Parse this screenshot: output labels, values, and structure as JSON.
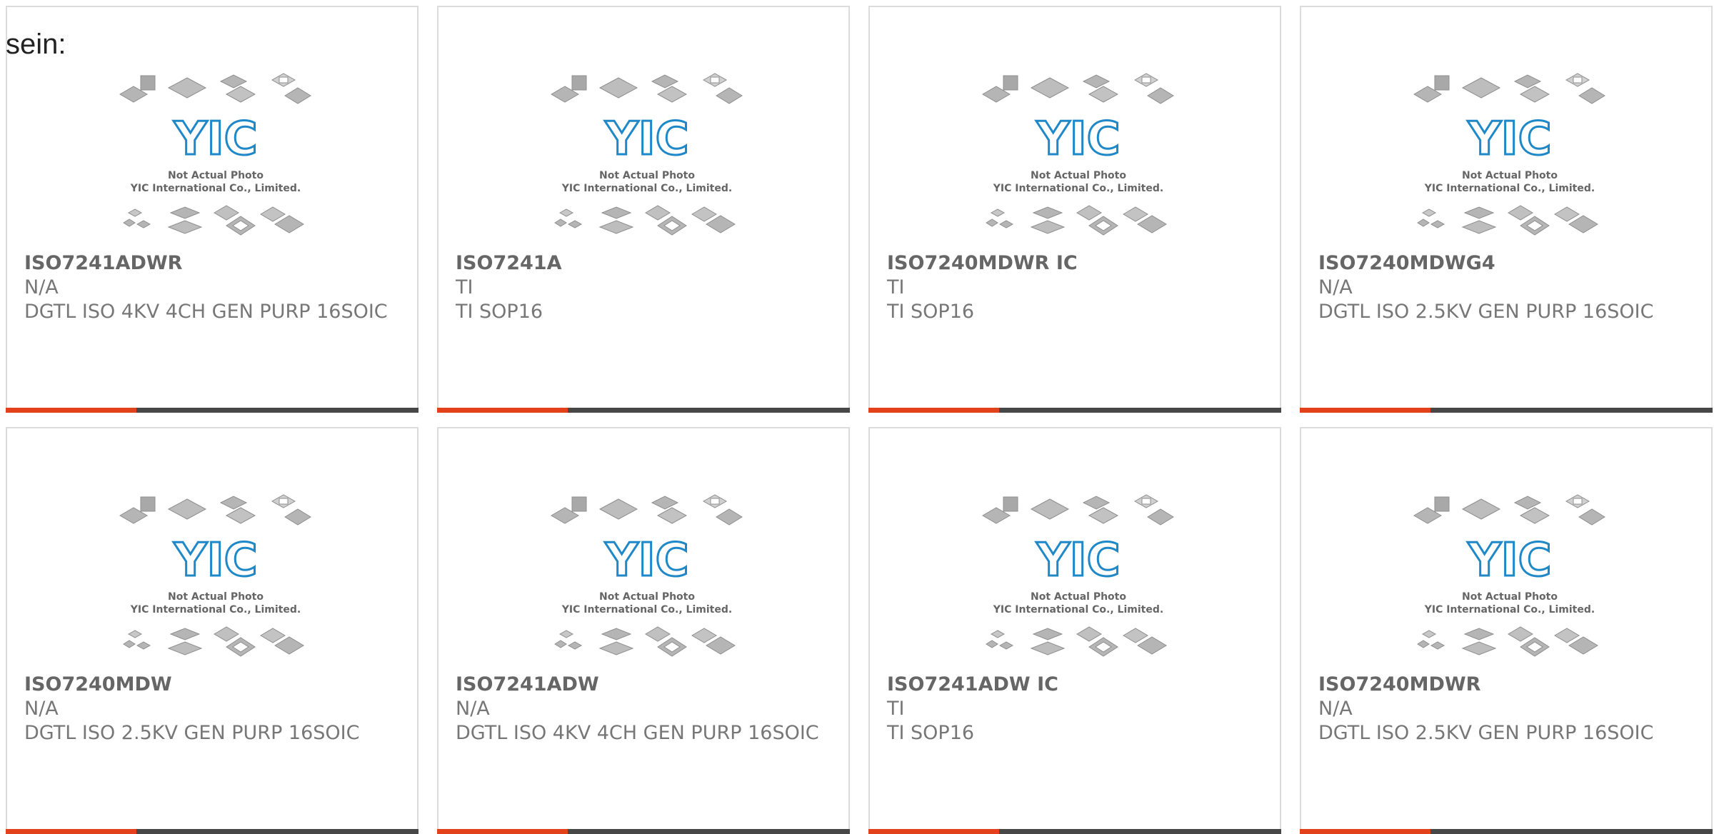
{
  "intro_text": "sein:",
  "placeholder_image": {
    "caption_line1": "Not Actual Photo",
    "caption_line2": "YIC International Co., Limited.",
    "logo_text": "YIC",
    "logo_color": "#1e88c8"
  },
  "colors": {
    "card_border": "#dcdcdc",
    "bar_accent": "#e3401c",
    "bar_dark": "#474747",
    "title_text": "#666666",
    "body_text": "#777777"
  },
  "products": [
    {
      "part": "ISO7241ADWR",
      "maker": "N/A",
      "description": "DGTL ISO 4KV 4CH GEN PURP 16SOIC"
    },
    {
      "part": "ISO7241A",
      "maker": "TI",
      "description": "TI SOP16"
    },
    {
      "part": "ISO7240MDWR IC",
      "maker": "TI",
      "description": "TI SOP16"
    },
    {
      "part": "ISO7240MDWG4",
      "maker": "N/A",
      "description": "DGTL ISO 2.5KV GEN PURP 16SOIC"
    },
    {
      "part": "ISO7240MDW",
      "maker": "N/A",
      "description": "DGTL ISO 2.5KV GEN PURP 16SOIC"
    },
    {
      "part": "ISO7241ADW",
      "maker": "N/A",
      "description": "DGTL ISO 4KV 4CH GEN PURP 16SOIC"
    },
    {
      "part": "ISO7241ADW IC",
      "maker": "TI",
      "description": "TI SOP16"
    },
    {
      "part": "ISO7240MDWR",
      "maker": "N/A",
      "description": "DGTL ISO 2.5KV GEN PURP 16SOIC"
    }
  ]
}
